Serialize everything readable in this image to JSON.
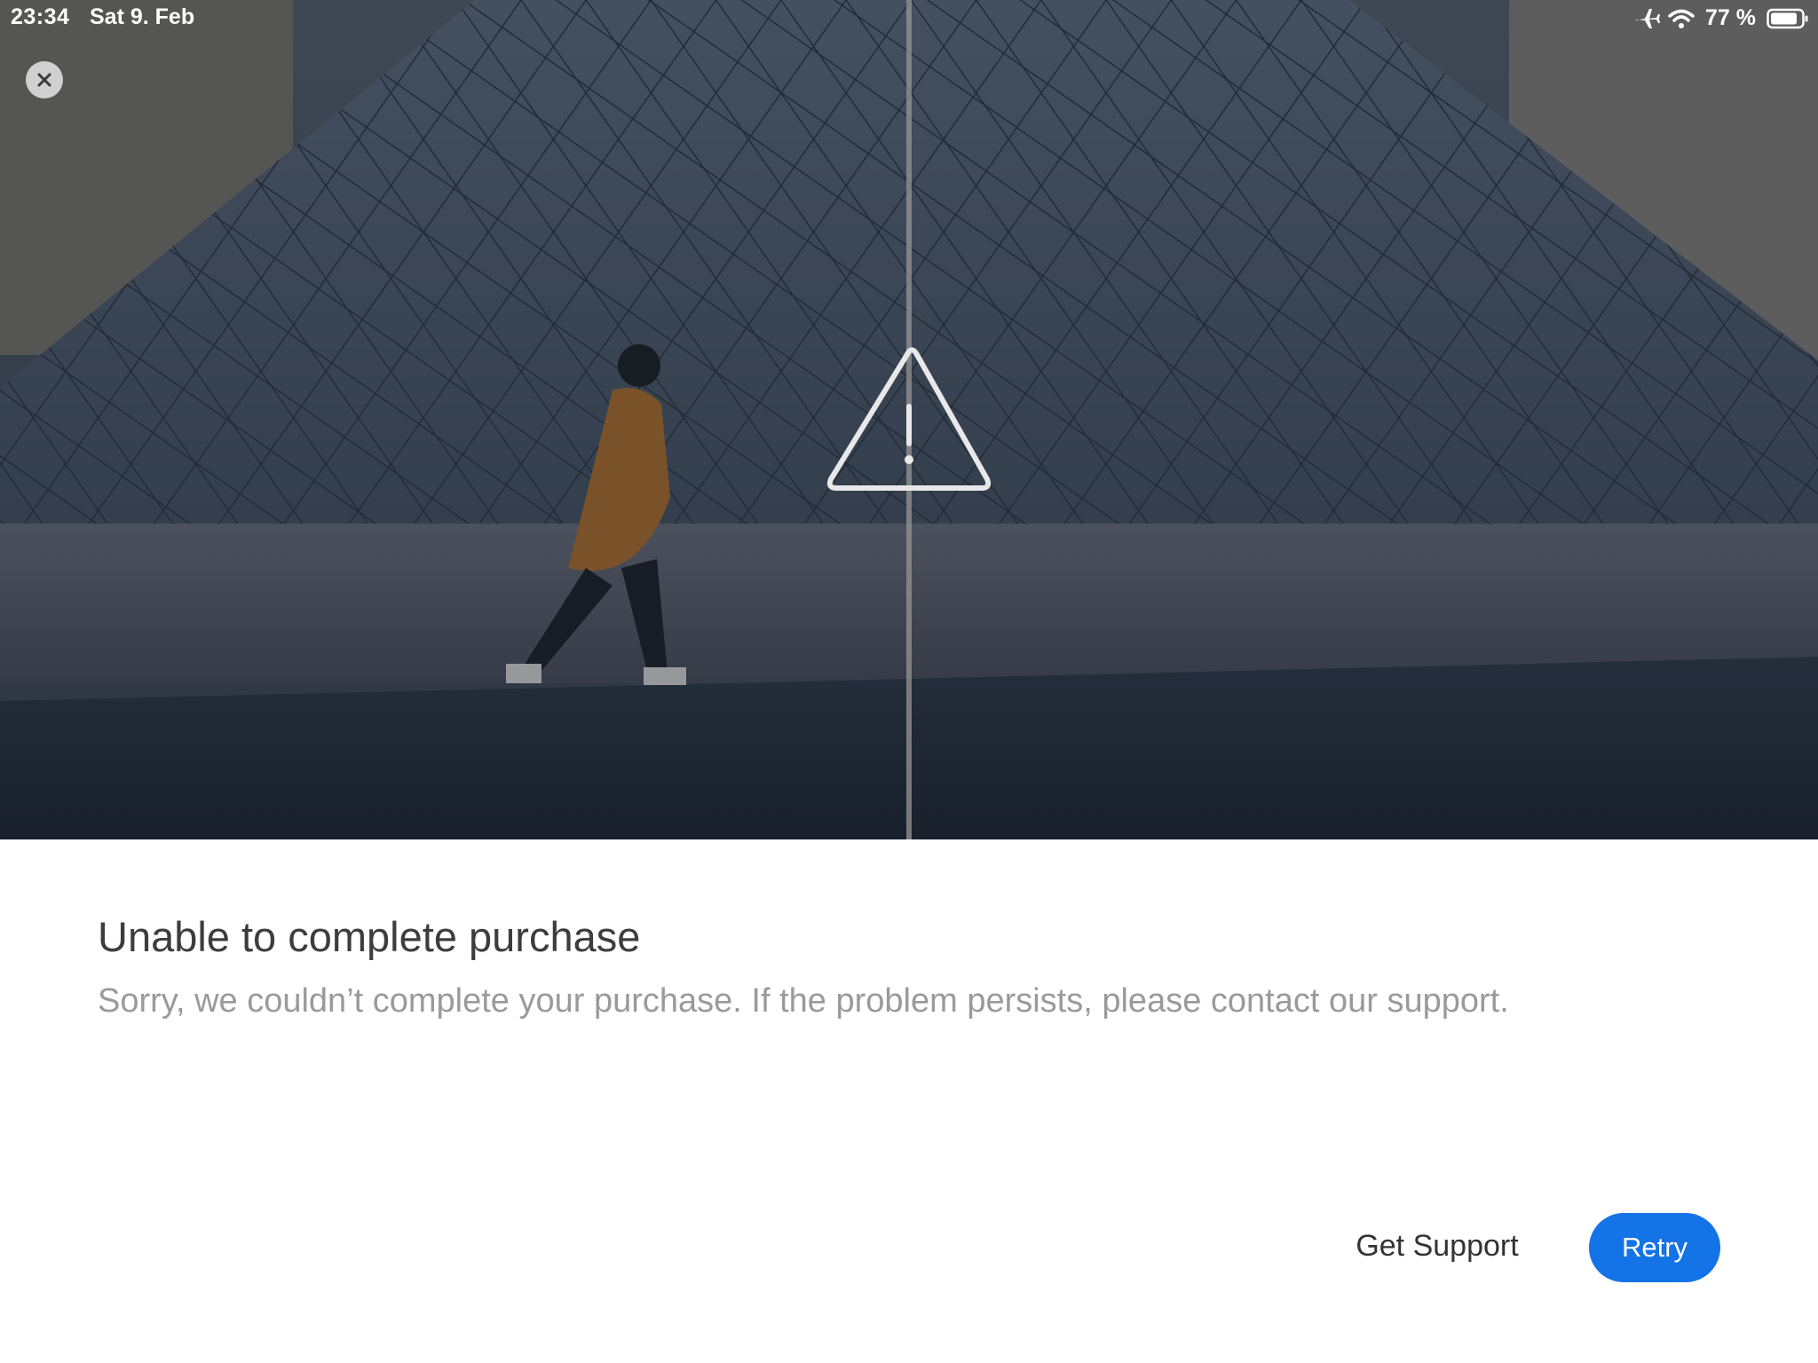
{
  "status_bar": {
    "time": "23:34",
    "date": "Sat 9. Feb",
    "battery": "77 %",
    "icons": [
      "airplane-icon",
      "wifi-icon",
      "battery-icon"
    ]
  },
  "hero": {
    "close_icon": "close-icon",
    "warning_icon": "warning-triangle-icon"
  },
  "dialog": {
    "title": "Unable to complete purchase",
    "message": "Sorry, we couldn’t complete your purchase. If the problem persists, please contact our support.",
    "support_label": "Get Support",
    "retry_label": "Retry"
  },
  "colors": {
    "accent": "#1473e6",
    "title": "#3d3d3d",
    "message": "#9a9a9a"
  }
}
